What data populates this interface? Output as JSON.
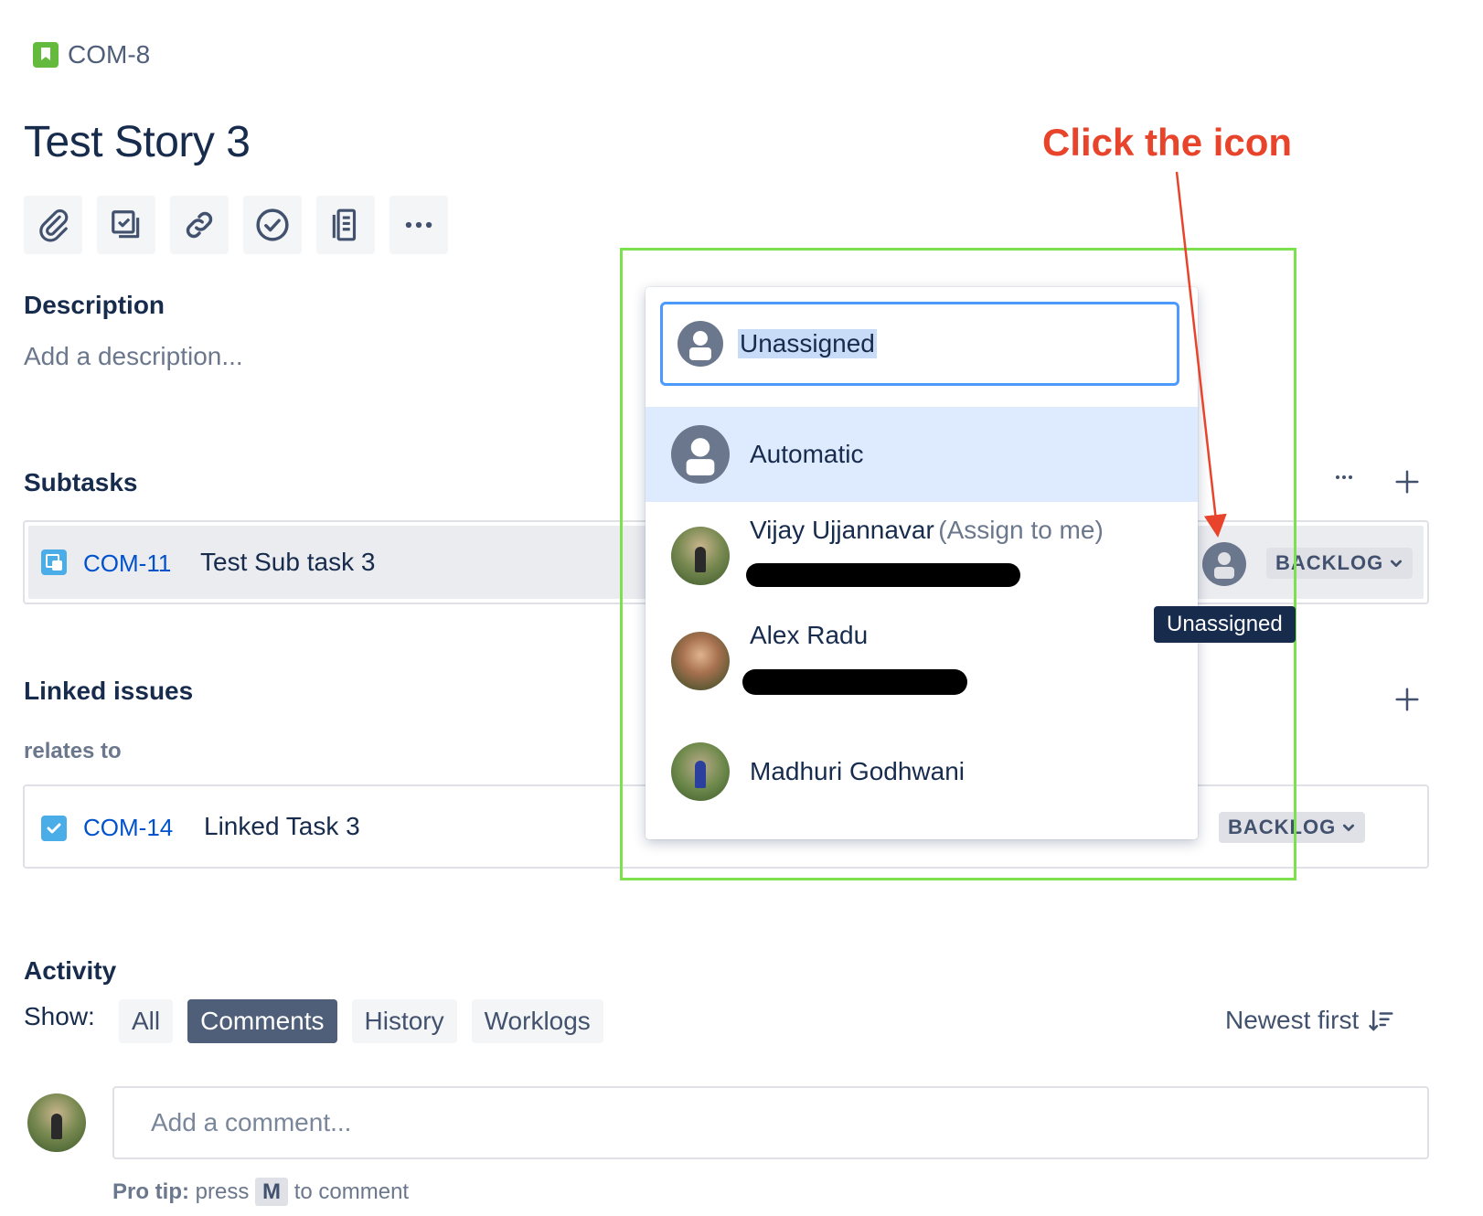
{
  "breadcrumb": {
    "issue_key": "COM-8"
  },
  "issue": {
    "title": "Test Story 3"
  },
  "toolbar": {
    "icons": [
      "attachment-icon",
      "subtask-icon",
      "link-icon",
      "checklist-icon",
      "document-icon",
      "more-icon"
    ]
  },
  "description": {
    "heading": "Description",
    "placeholder": "Add a description..."
  },
  "subtasks": {
    "heading": "Subtasks",
    "items": [
      {
        "key": "COM-11",
        "title": "Test Sub task 3",
        "status": "BACKLOG"
      }
    ]
  },
  "linked_issues": {
    "heading": "Linked issues",
    "relation": "relates to",
    "items": [
      {
        "key": "COM-14",
        "title": "Linked Task 3",
        "status": "BACKLOG"
      }
    ]
  },
  "assignee_dropdown": {
    "input_value": "Unassigned",
    "options": [
      {
        "name": "Automatic",
        "selected": true
      },
      {
        "name": "Vijay Ujjannavar",
        "suffix": "(Assign to me)"
      },
      {
        "name": "Alex Radu"
      },
      {
        "name": "Madhuri Godhwani"
      }
    ]
  },
  "tooltip": {
    "text": "Unassigned"
  },
  "annotation": {
    "text": "Click the icon",
    "color": "#E8432B"
  },
  "activity": {
    "heading": "Activity",
    "show_label": "Show:",
    "filters": [
      "All",
      "Comments",
      "History",
      "Worklogs"
    ],
    "active_filter": "Comments",
    "sort_label": "Newest first",
    "comment_placeholder": "Add a comment...",
    "pro_tip_label": "Pro tip:",
    "pro_tip_press": "press",
    "pro_tip_key": "M",
    "pro_tip_suffix": "to comment"
  },
  "colors": {
    "accent": "#0052CC",
    "selection": "#DEEBFF",
    "focus": "#4C9AFF",
    "highlight_box": "#7CE04F"
  }
}
